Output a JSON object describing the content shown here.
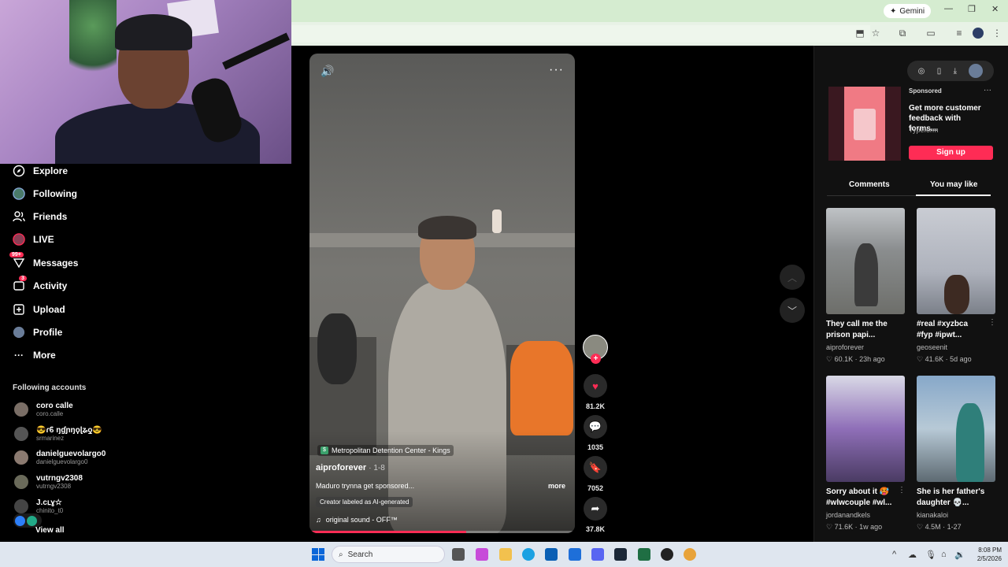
{
  "browser": {
    "gemini_label": "Gemini"
  },
  "sidebar": {
    "nav": [
      {
        "label": "Explore",
        "icon": "compass-icon"
      },
      {
        "label": "Following",
        "icon": "following-avatar-icon"
      },
      {
        "label": "Friends",
        "icon": "friends-icon"
      },
      {
        "label": "LIVE",
        "icon": "live-icon"
      },
      {
        "label": "Messages",
        "icon": "messages-icon",
        "badge": "99+"
      },
      {
        "label": "Activity",
        "icon": "activity-icon",
        "badge": "3"
      },
      {
        "label": "Upload",
        "icon": "upload-icon"
      },
      {
        "label": "Profile",
        "icon": "profile-avatar-icon"
      },
      {
        "label": "More",
        "icon": "more-icon"
      }
    ],
    "following_title": "Following accounts",
    "accounts": [
      {
        "name": "coro calle",
        "handle": "coro.calle"
      },
      {
        "name": "😎ɾϐ ŋɠɲŋϙɭʑƍ😎",
        "handle": "srmarinez"
      },
      {
        "name": "danielguevolargo0",
        "handle": "danielguevolargo0"
      },
      {
        "name": "vutrngv2308",
        "handle": "vutrngv2308"
      },
      {
        "name": "J.cւɣ☆",
        "handle": "chinito_t0"
      }
    ],
    "view_all": "View all"
  },
  "video": {
    "location": "Metropolitan Detention Center - Kings",
    "author": "aiproforever",
    "date": "· 1-8",
    "caption": "Maduro trynna get sponsored...",
    "more": "more",
    "ai_label": "Creator labeled as AI-generated",
    "sound": "original sound - OFF™",
    "progress": 0.59
  },
  "actions": {
    "likes": "81.2K",
    "comments": "1035",
    "saves": "7052",
    "shares": "37.8K"
  },
  "ad": {
    "sponsored": "Sponsored",
    "title": "Get more customer feedback with forms...",
    "brand": "Typeform",
    "cta": "Sign up"
  },
  "tabs": {
    "comments": "Comments",
    "you_may_like": "You may like",
    "active": "You may like"
  },
  "recommendations": [
    {
      "title": "They call me the prison papi...",
      "author": "aiproforever",
      "likes": "60.1K",
      "age": "23h ago"
    },
    {
      "title": "#real #xyzbca #fyp #ipwt...",
      "author": "geoseenit",
      "likes": "41.6K",
      "age": "5d ago"
    },
    {
      "title": "Sorry about it 🥵 #wlwcouple #wl...",
      "author": "jordanandkels",
      "likes": "71.6K",
      "age": "1w ago"
    },
    {
      "title": "She is her father's daughter 💀...",
      "author": "kianakaloi",
      "likes": "4.5M",
      "age": "1-27"
    }
  ],
  "taskbar": {
    "search_placeholder": "Search",
    "time": "8:08 PM",
    "date": "2/5/2026"
  }
}
